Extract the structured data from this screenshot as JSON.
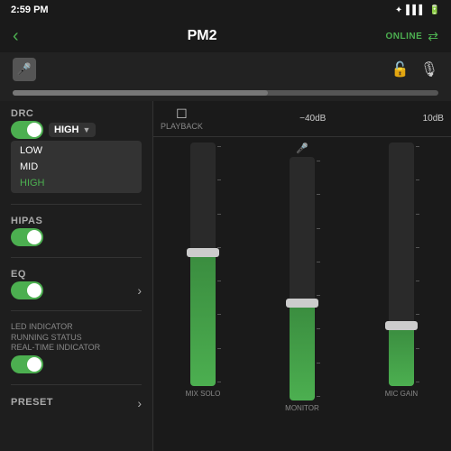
{
  "statusBar": {
    "time": "2:59 PM",
    "icons": "🔋📶"
  },
  "header": {
    "back": "‹",
    "title": "PM2",
    "onlineLabel": "ONLINE",
    "linkIcon": "⇄"
  },
  "topControls": {
    "micIcon": "🎤",
    "lockIcon": "🔓",
    "micTopIcon": "🎙"
  },
  "drc": {
    "label": "DRC",
    "toggle": true,
    "selectedValue": "HIGH",
    "options": [
      "LOW",
      "MID",
      "HIGH"
    ]
  },
  "hipas": {
    "label": "HIPAS",
    "toggle": true
  },
  "eq": {
    "label": "EQ",
    "toggle": true
  },
  "led": {
    "label": "LED INDICATOR",
    "line2": "RUNNING STATUS",
    "line3": "REAL-TIME INDICATOR",
    "toggle": true
  },
  "preset": {
    "label": "PRESET",
    "arrow": "›"
  },
  "playback": {
    "icon": "☐",
    "label": "PLAYBACK",
    "db1": "−40dB",
    "db2": "10dB"
  },
  "sliders": [
    {
      "id": "mix-solo",
      "fillHeight": "55%",
      "thumbPos": "42%",
      "mainLabel": "",
      "subLabel": "MIX SOLO"
    },
    {
      "id": "monitor",
      "fillHeight": "40%",
      "thumbPos": "57%",
      "mainLabel": "🎤",
      "subLabel": "MONITOR"
    },
    {
      "id": "mic-gain",
      "fillHeight": "25%",
      "thumbPos": "72%",
      "mainLabel": "",
      "subLabel": "MIC GAIN"
    }
  ],
  "colors": {
    "accent": "#4caf50",
    "bg": "#1a1a1a",
    "panel": "#222",
    "text": "#ffffff",
    "muted": "#888888"
  }
}
